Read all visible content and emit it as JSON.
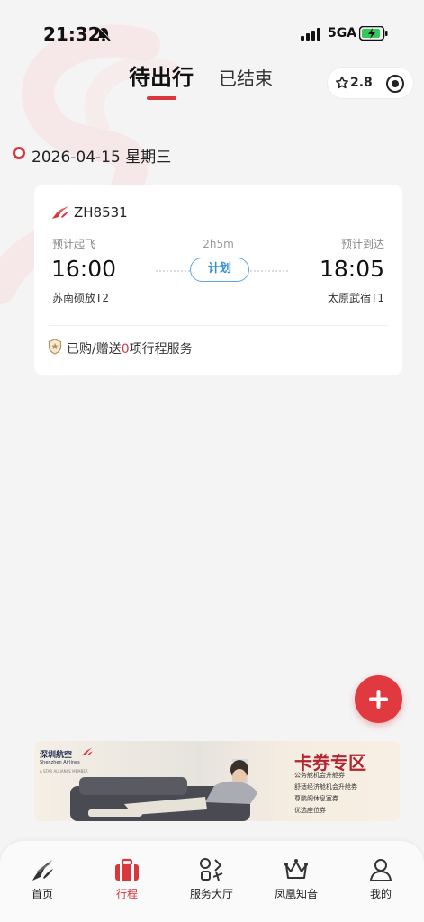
{
  "status_bar": {
    "time": "21:32",
    "network": "5GA"
  },
  "header": {
    "tabs": [
      {
        "label": "待出行",
        "active": true
      },
      {
        "label": "已结束",
        "active": false
      }
    ],
    "capsule": {
      "rating": "2.8",
      "star_icon": "star-outline-icon",
      "target_icon": "target-icon"
    }
  },
  "trip": {
    "date": "2026-04-15 星期三",
    "flight": {
      "number": "ZH8531",
      "departure_label": "预计起飞",
      "arrival_label": "预计到达",
      "duration": "2h5m",
      "departure_time": "16:00",
      "arrival_time": "18:05",
      "status": "计划",
      "departure_airport": "苏南硕放T2",
      "arrival_airport": "太原武宿T1"
    },
    "services": {
      "prefix": "已购/赠送",
      "count": "0",
      "suffix": "项行程服务"
    }
  },
  "banner": {
    "airline_cn": "深圳航空",
    "airline_en": "Shenzhen Airlines",
    "alliance": "A STAR ALLIANCE MEMBER",
    "title": "卡券专区",
    "items": [
      "公务舱机会升舱券",
      "舒适经济舱机会升舱券",
      "尊鹏阁休息室券",
      "优选座位券"
    ]
  },
  "nav": {
    "items": [
      {
        "label": "首页",
        "icon": "airline-logo-icon",
        "active": false
      },
      {
        "label": "行程",
        "icon": "suitcase-icon",
        "active": true
      },
      {
        "label": "服务大厅",
        "icon": "services-grid-icon",
        "active": false
      },
      {
        "label": "凤凰知音",
        "icon": "crown-icon",
        "active": false
      },
      {
        "label": "我的",
        "icon": "person-icon",
        "active": false
      }
    ]
  },
  "colors": {
    "accent": "#d9363e",
    "status_blue": "#3a8ed8",
    "background": "#f4f4f5"
  }
}
